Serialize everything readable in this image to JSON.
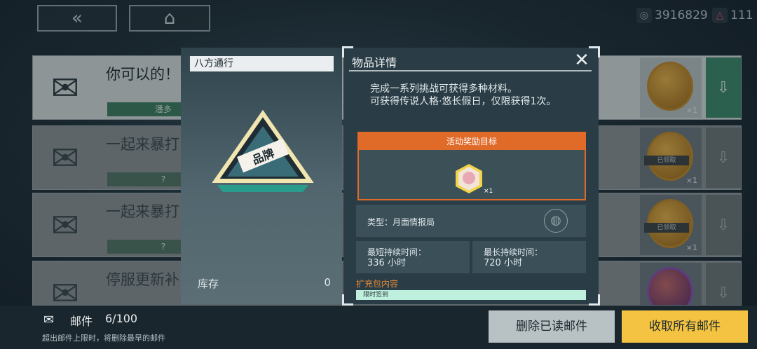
{
  "topbar": {
    "back_glyph": "«",
    "home_glyph": "⌂",
    "currencies": [
      {
        "icon": "coin-icon",
        "glyph": "◎",
        "value": "3916829"
      },
      {
        "icon": "gem-icon",
        "glyph": "△",
        "value": "111"
      }
    ]
  },
  "mails": [
    {
      "title": "你可以的！",
      "sender": "潘多",
      "claimed": false,
      "reward_count": "×1"
    },
    {
      "title": "一起来暴打",
      "sender": "?",
      "claimed": true,
      "reward_count": "×1",
      "claimed_label": "已领取"
    },
    {
      "title": "一起来暴打",
      "sender": "?",
      "claimed": true,
      "reward_count": "×1",
      "claimed_label": "已领取"
    },
    {
      "title": "停服更新补",
      "sender": "",
      "claimed": true,
      "reward_count": ""
    }
  ],
  "item_panel": {
    "title": "八方通行",
    "badge_text": "品牌",
    "stock_label": "库存",
    "stock_value": "0"
  },
  "detail": {
    "title": "物品详情",
    "description": "完成一系列挑战可获得多种材料。\n可获得传说人格·悠长假日，仅限获得1次。",
    "target_header": "活动奖励目标",
    "target_count": "×1",
    "type_label": "类型：月面情报局",
    "min_label": "最短持续时间：",
    "min_value": "336 小时",
    "max_label": "最长持续时间：",
    "max_value": "720 小时",
    "pack_label": "扩充包内容",
    "pack_item": "限时签到"
  },
  "bottom": {
    "mail_label": "邮件",
    "mail_count": "6/100",
    "note": "超出邮件上限时，将删除最早的邮件",
    "delete_label": "删除已读邮件",
    "collect_label": "收取所有邮件"
  },
  "colors": {
    "accent_orange": "#e06a28",
    "accent_yellow": "#f3c341",
    "claim_green": "#3f8a6c"
  }
}
